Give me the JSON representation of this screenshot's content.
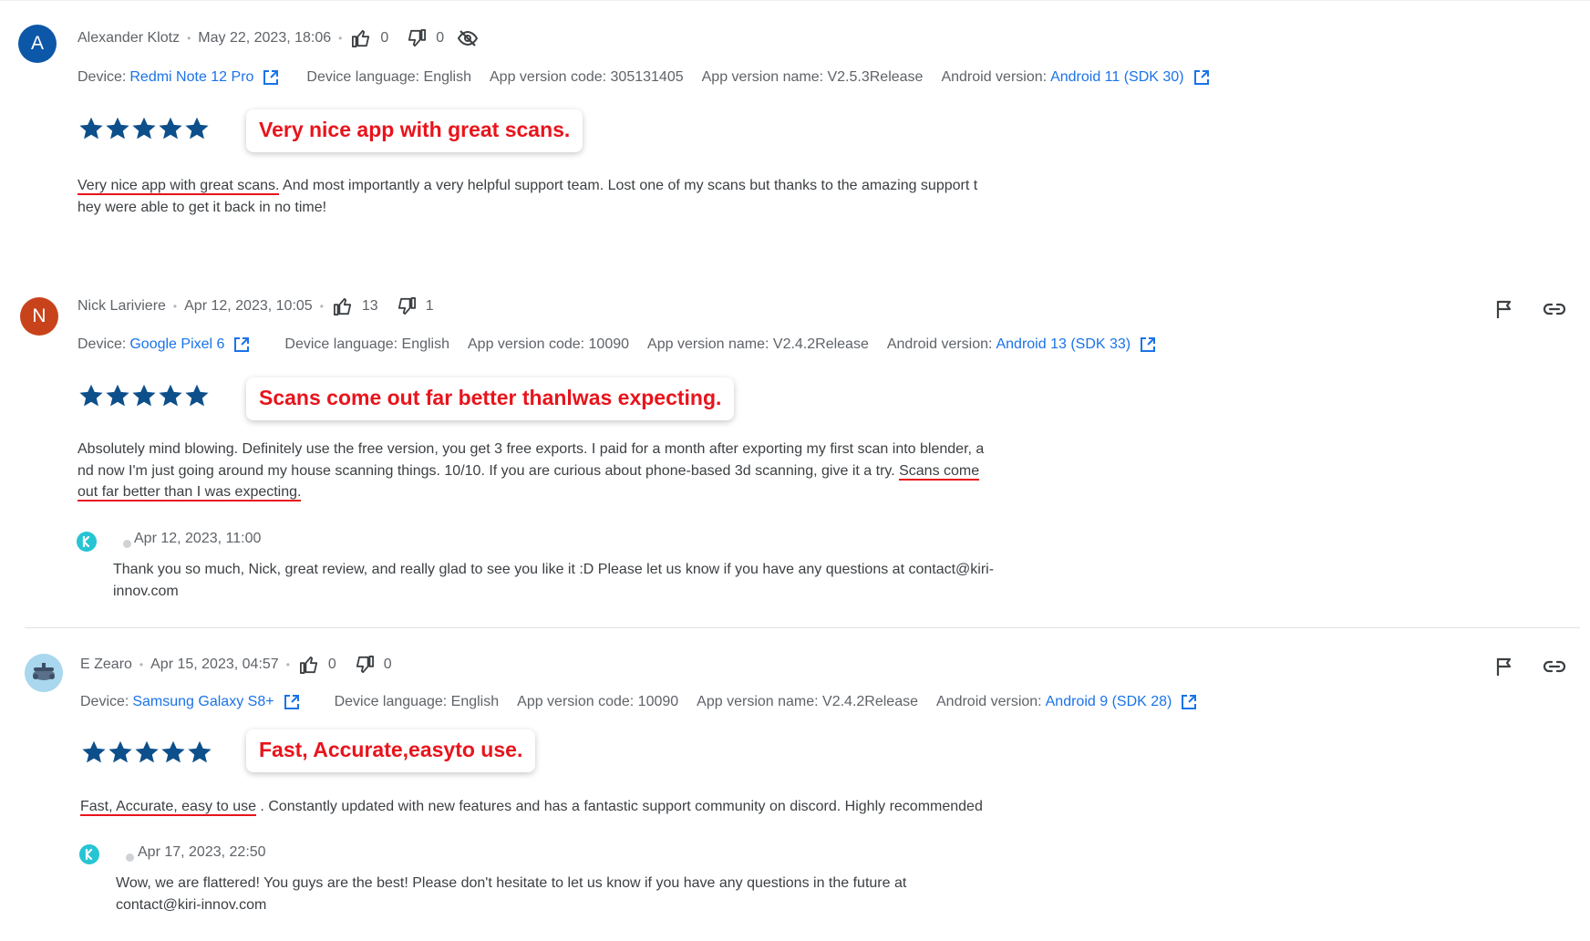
{
  "colors": {
    "star": "#0d4f8b",
    "link": "#1a73e8",
    "highlight": "#e8141c",
    "reply_logo": "#27c4d4"
  },
  "labels": {
    "device": "Device:",
    "device_language": "Device language:",
    "app_version_code": "App version code:",
    "app_version_name": "App version name:",
    "android_version": "Android version:"
  },
  "reviews": [
    {
      "avatar_letter": "A",
      "avatar_color": "#0d57a8",
      "author": "Alexander Klotz",
      "date": "May 22, 2023, 18:06",
      "thumbs_up": "0",
      "thumbs_down": "0",
      "device": "Redmi Note 12 Pro",
      "device_language": "English",
      "app_version_code": "305131405",
      "app_version_name": "V2.5.3Release",
      "android_version": "Android 11 (SDK 30)",
      "rating": 5,
      "callout": "Very nice app with great scans.",
      "text_underlined": "Very nice app with great scans.",
      "text_rest": " And most importantly a very helpful support team. Lost one of my scans but thanks to the amazing support t\nhey were able to get it back in no time!"
    },
    {
      "avatar_letter": "N",
      "avatar_color": "#c8431c",
      "author": "Nick Lariviere",
      "date": "Apr 12, 2023, 10:05",
      "thumbs_up": "13",
      "thumbs_down": "1",
      "device": "Google Pixel 6",
      "device_language": "English",
      "app_version_code": "10090",
      "app_version_name": "V2.4.2Release",
      "android_version": "Android 13 (SDK 33)",
      "rating": 5,
      "callout": "Scans come out far better thanlwas expecting.",
      "text_plain": "Absolutely mind blowing. Definitely use the free version, you get 3 free exports. I paid for a month after exporting my first scan into blender, a\nnd now I'm just going around my house scanning things. 10/10. If you are curious about phone-based 3d scanning, give it a try. ",
      "text_underlined_1": "Scans come",
      "text_underlined_2": "out far better than I was expecting.",
      "reply_date": "Apr 12, 2023, 11:00",
      "reply_text": "Thank you so much, Nick, great review, and really glad to see you like it :D Please let us know if you have any questions at contact@kiri-\ninnov.com"
    },
    {
      "avatar_letter": "",
      "author": "E Zearo",
      "date": "Apr 15, 2023, 04:57",
      "thumbs_up": "0",
      "thumbs_down": "0",
      "device": "Samsung Galaxy S8+",
      "device_language": "English",
      "app_version_code": "10090",
      "app_version_name": "V2.4.2Release",
      "android_version": "Android 9 (SDK 28)",
      "rating": 5,
      "callout": "Fast, Accurate,easyto use.",
      "text_underlined": "Fast, Accurate, easy to use",
      "text_rest": " . Constantly updated with new features and has a fantastic support community on discord. Highly recommended",
      "reply_date": "Apr 17, 2023, 22:50",
      "reply_text": "Wow, we are flattered! You guys are the best! Please don't hesitate to let us know if you have any questions in the future at\ncontact@kiri-innov.com"
    }
  ],
  "icons": {
    "thumbs_up": "thumbs-up-icon",
    "thumbs_down": "thumbs-down-icon",
    "hidden": "eye-off-icon",
    "external": "open-in-new-icon",
    "flag": "flag-icon",
    "link": "link-icon",
    "star": "star-icon",
    "reply_logo": "kiri-logo-icon"
  }
}
